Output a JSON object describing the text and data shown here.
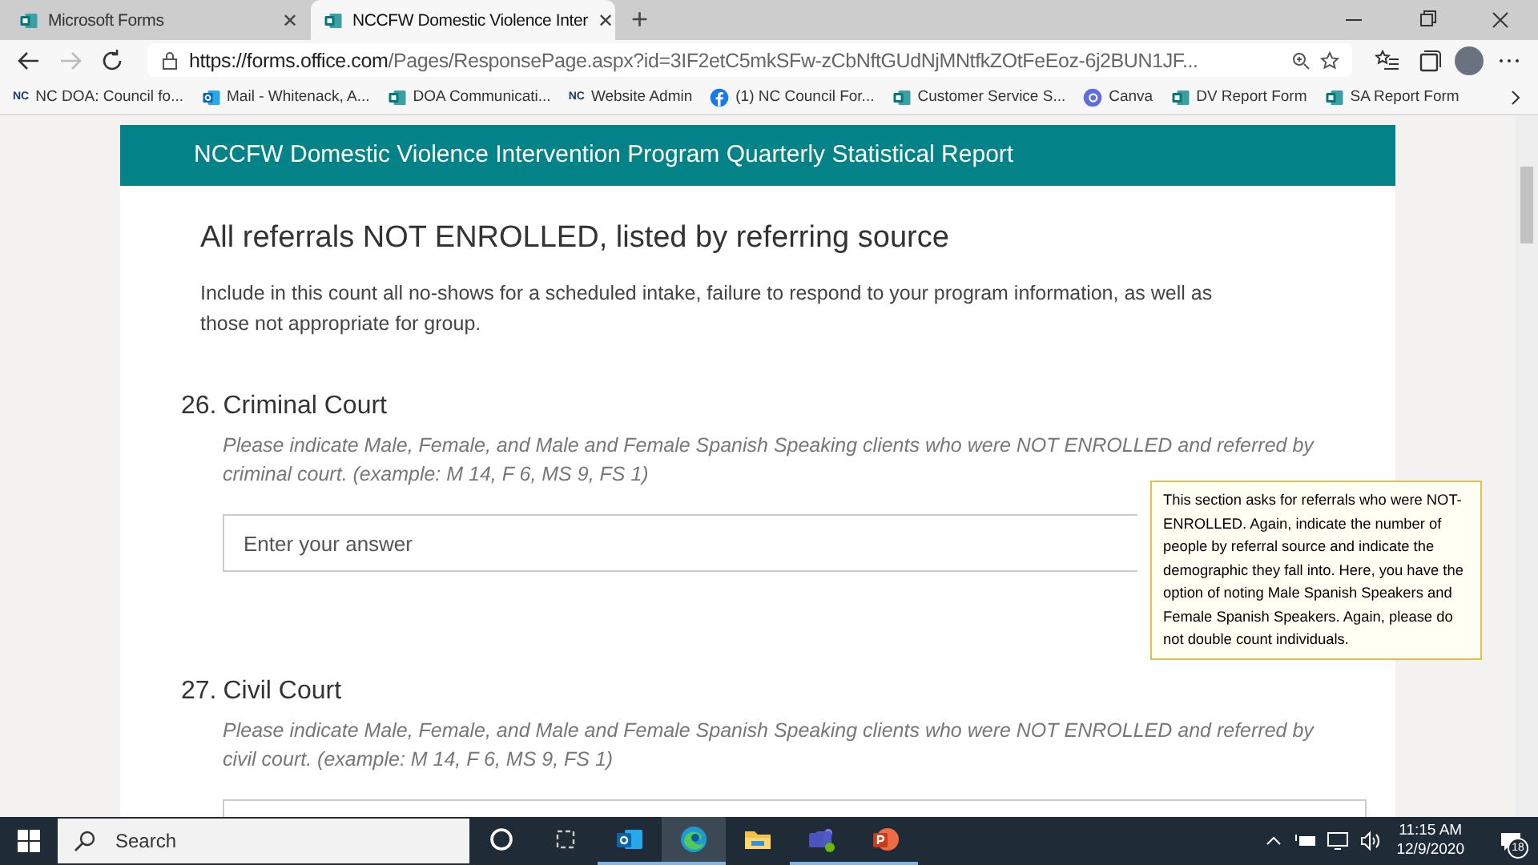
{
  "browser": {
    "tabs": [
      {
        "title": "Microsoft Forms",
        "close": "✕",
        "selected": false
      },
      {
        "title": "NCCFW Domestic Violence Inter",
        "close": "✕",
        "selected": true
      }
    ],
    "new_tab": "+",
    "address": {
      "host": "https://forms.office.com",
      "path": "/Pages/ResponsePage.aspx?id=3IF2etC5mkSFw-zCbNftGUdNjMNtfkZOtFeEoz-6j2BUN1JF..."
    },
    "bookmarks": [
      {
        "kind": "nc",
        "logo": "NC",
        "label": "NC DOA: Council fo..."
      },
      {
        "kind": "outlook",
        "label": "Mail - Whitenack, A..."
      },
      {
        "kind": "forms",
        "label": "DOA Communicati..."
      },
      {
        "kind": "nc",
        "logo": "NC",
        "label": "Website Admin"
      },
      {
        "kind": "facebook",
        "label": "(1) NC Council For..."
      },
      {
        "kind": "forms",
        "label": "Customer Service S..."
      },
      {
        "kind": "canva",
        "label": "Canva"
      },
      {
        "kind": "forms",
        "label": "DV Report Form"
      },
      {
        "kind": "forms",
        "label": "SA Report Form"
      }
    ]
  },
  "form": {
    "header": "NCCFW Domestic Violence Intervention Program Quarterly Statistical Report",
    "section_title": "All referrals NOT ENROLLED, listed by referring source",
    "section_description": "Include in this count all no-shows for a scheduled intake, failure to respond to your program information, as well as those not appropriate for group.",
    "questions": [
      {
        "number": "26.",
        "title": "Criminal Court",
        "hint": "Please indicate Male, Female, and Male and Female Spanish Speaking clients who were NOT ENROLLED and referred by criminal court. (example: M 14, F 6, MS 9, FS 1)",
        "placeholder": "Enter your answer"
      },
      {
        "number": "27.",
        "title": "Civil Court",
        "hint": "Please indicate Male, Female, and Male and Female Spanish Speaking clients who were NOT ENROLLED and referred by civil court. (example: M 14, F 6, MS 9, FS 1)"
      }
    ]
  },
  "callout": "This section asks for referrals who were NOT-ENROLLED.  Again, indicate the number of people by referral source and indicate the demographic they fall into.  Here, you have the option of noting Male Spanish Speakers and Female Spanish Speakers. Again, please do not double count individuals.",
  "taskbar": {
    "search_placeholder": "Search",
    "apps": [
      {
        "kind": "cortana",
        "running": false,
        "selected": false
      },
      {
        "kind": "taskview",
        "running": false,
        "selected": false
      },
      {
        "kind": "outlook",
        "running": true,
        "selected": false
      },
      {
        "kind": "edge",
        "running": true,
        "selected": true
      },
      {
        "kind": "explorer",
        "running": false,
        "selected": false
      },
      {
        "kind": "teams",
        "running": true,
        "selected": false
      },
      {
        "kind": "powerpoint",
        "running": true,
        "selected": false
      }
    ],
    "time": "11:15 AM",
    "date": "12/9/2020",
    "notifications": "18"
  }
}
